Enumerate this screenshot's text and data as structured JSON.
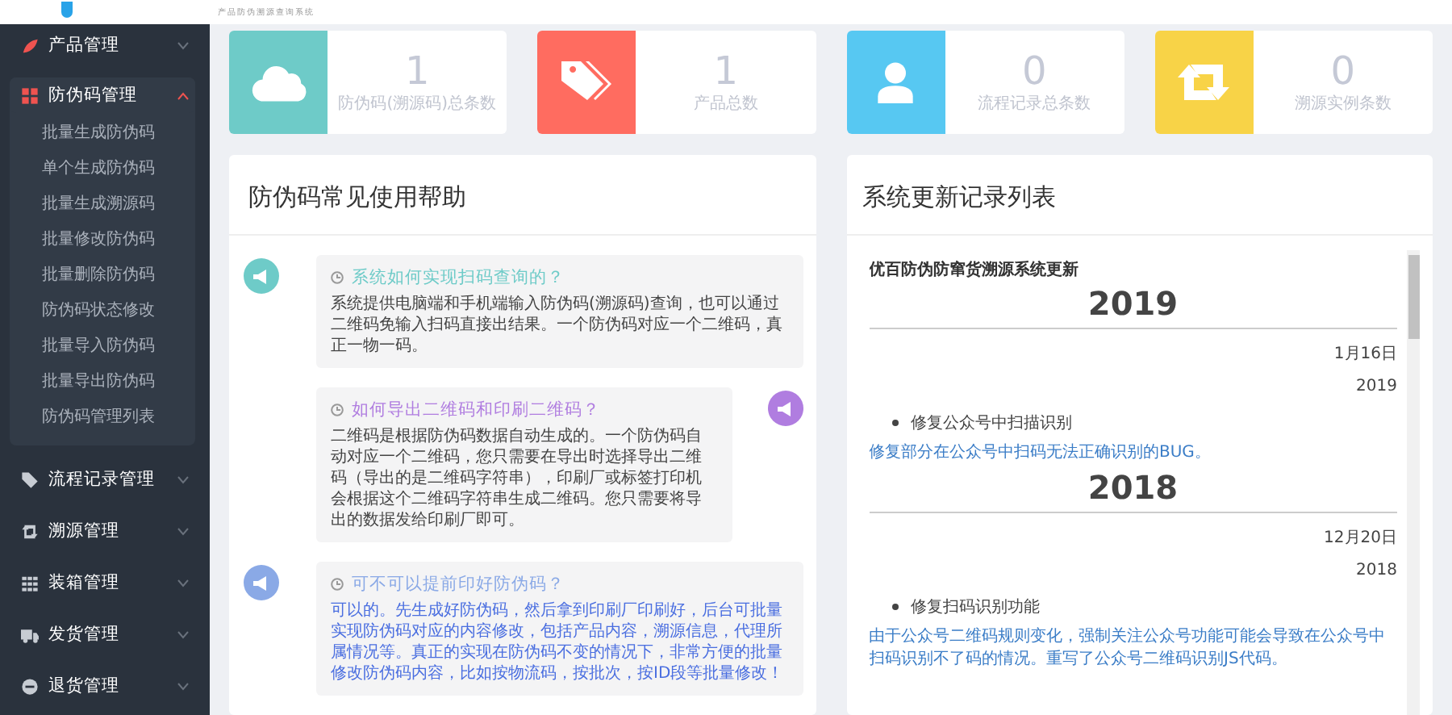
{
  "header": {
    "subtitle": "产品防伪溯源查询系统"
  },
  "sidebar": {
    "items": [
      {
        "label": "产品管理",
        "expanded": false
      },
      {
        "label": "防伪码管理",
        "expanded": true,
        "children": [
          {
            "label": "批量生成防伪码"
          },
          {
            "label": "单个生成防伪码"
          },
          {
            "label": "批量生成溯源码"
          },
          {
            "label": "批量修改防伪码"
          },
          {
            "label": "批量删除防伪码"
          },
          {
            "label": "防伪码状态修改"
          },
          {
            "label": "批量导入防伪码"
          },
          {
            "label": "批量导出防伪码"
          },
          {
            "label": "防伪码管理列表"
          }
        ]
      },
      {
        "label": "流程记录管理",
        "expanded": false
      },
      {
        "label": "溯源管理",
        "expanded": false
      },
      {
        "label": "装箱管理",
        "expanded": false
      },
      {
        "label": "发货管理",
        "expanded": false
      },
      {
        "label": "退货管理",
        "expanded": false
      }
    ]
  },
  "stats": [
    {
      "color": "#6ecbc8",
      "value": "1",
      "label": "防伪码(溯源码)总条数"
    },
    {
      "color": "#ff6c60",
      "value": "1",
      "label": "产品总数"
    },
    {
      "color": "#57c8f2",
      "value": "0",
      "label": "流程记录总条数"
    },
    {
      "color": "#f8d347",
      "value": "0",
      "label": "溯源实例条数"
    }
  ],
  "help_panel": {
    "title": "防伪码常见使用帮助",
    "items": [
      {
        "color": "#6ecbc8",
        "title": "系统如何实现扫码查询的？",
        "body": "系统提供电脑端和手机端输入防伪码(溯源码)查询，也可以通过二维码免输入扫码直接出结果。一个防伪码对应一个二维码，真正一物一码。",
        "kind": "plain"
      },
      {
        "color": "#b07de0",
        "title": "如何导出二维码和印刷二维码？",
        "body": "二维码是根据防伪码数据自动生成的。一个防伪码自动对应一个二维码，您只需要在导出时选择导出二维码（导出的是二维码字符串），印刷厂或标签打印机会根据这个二维码字符串生成二维码。您只需要将导出的数据发给印刷厂即可。",
        "kind": "plain"
      },
      {
        "color": "#8aa9e6",
        "title": "可不可以提前印好防伪码？",
        "body": "可以的。先生成好防伪码，然后拿到印刷厂印刷好，后台可批量实现防伪码对应的内容修改，包括产品内容，溯源信息，代理所属情况等。真正的实现在防伪码不变的情况下，非常方便的批量修改防伪码内容，比如按物流码，按批次，按ID段等批量修改！",
        "kind": "link"
      }
    ]
  },
  "update_panel": {
    "title": "系统更新记录列表",
    "heading": "优百防伪防窜货溯源系统更新",
    "years": [
      {
        "year": "2019",
        "entries": [
          {
            "date": "1月16日",
            "year": "2019",
            "item": "修复公众号中扫描识别",
            "detail": "修复部分在公众号中扫码无法正确识别的BUG。"
          }
        ]
      },
      {
        "year": "2018",
        "entries": [
          {
            "date": "12月20日",
            "year": "2018",
            "item": "修复扫码识别功能",
            "detail": "由于公众号二维码规则变化，强制关注公众号功能可能会导致在公众号中扫码识别不了码的情况。重写了公众号二维码识别JS代码。"
          }
        ]
      }
    ]
  }
}
